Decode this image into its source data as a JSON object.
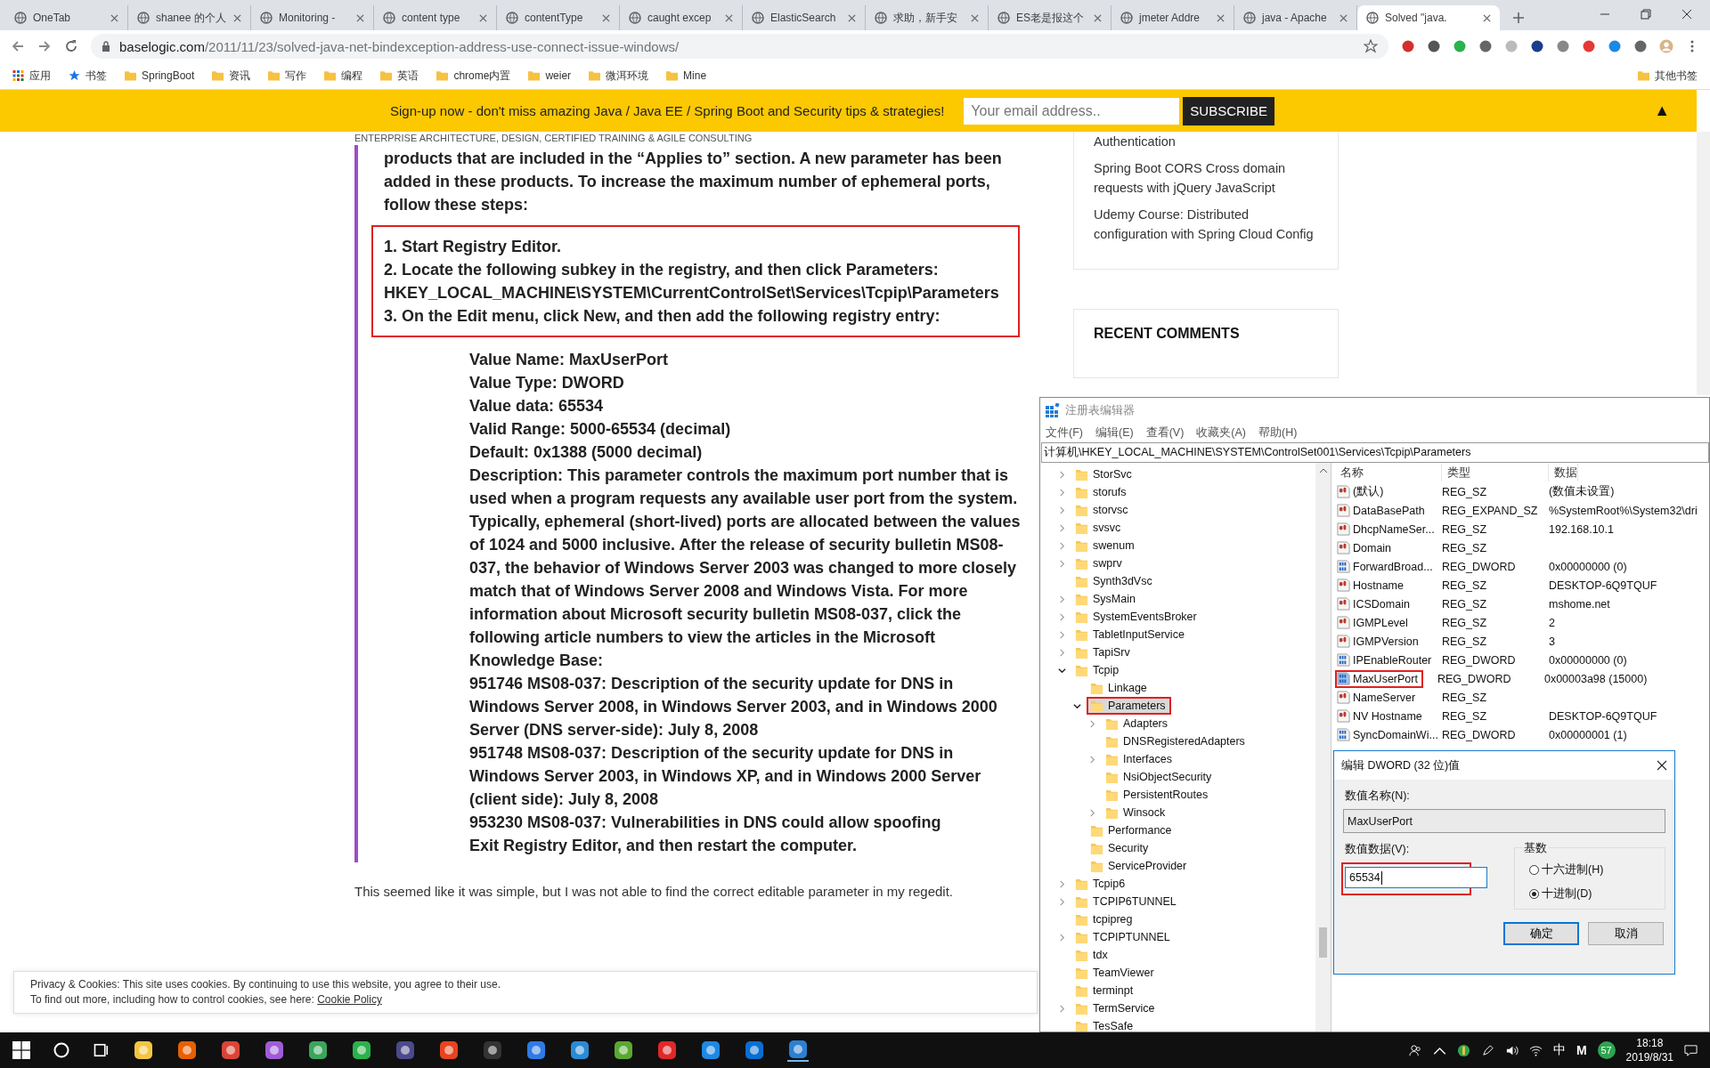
{
  "browser": {
    "tabs": [
      {
        "title": "OneTab",
        "selected": false
      },
      {
        "title": "shanee 的个人",
        "selected": false
      },
      {
        "title": "Monitoring -",
        "selected": false
      },
      {
        "title": "content type",
        "selected": false
      },
      {
        "title": "contentType",
        "selected": false
      },
      {
        "title": "caught excep",
        "selected": false
      },
      {
        "title": "ElasticSearch",
        "selected": false
      },
      {
        "title": "求助，新手安",
        "selected": false
      },
      {
        "title": "ES老是报这个",
        "selected": false
      },
      {
        "title": "jmeter Addre",
        "selected": false
      },
      {
        "title": "java - Apache",
        "selected": false
      },
      {
        "title": "Solved \"java.",
        "selected": true
      }
    ],
    "url": {
      "host": "baselogic.com",
      "path": "/2011/11/23/solved-java-net-bindexception-address-use-connect-issue-windows/"
    },
    "bookmarks": [
      {
        "label": "应用",
        "kind": "apps"
      },
      {
        "label": "书签",
        "kind": "star"
      },
      {
        "label": "SpringBoot",
        "kind": "folder"
      },
      {
        "label": "资讯",
        "kind": "folder"
      },
      {
        "label": "写作",
        "kind": "folder"
      },
      {
        "label": "编程",
        "kind": "folder"
      },
      {
        "label": "英语",
        "kind": "folder"
      },
      {
        "label": "chrome内置",
        "kind": "folder"
      },
      {
        "label": "weier",
        "kind": "folder"
      },
      {
        "label": "微洱环境",
        "kind": "folder"
      },
      {
        "label": "Mine",
        "kind": "folder"
      }
    ],
    "other_bookmarks": "其他书签"
  },
  "page": {
    "banner": {
      "text": "Sign-up now - don't miss amazing Java / Java EE / Spring Boot and Security tips & strategies!",
      "email_placeholder": "Your email address..",
      "subscribe": "SUBSCRIBE",
      "collapse": "▲"
    },
    "tagline": "ENTERPRISE ARCHITECTURE, DESIGN, CERTIFIED TRAINING & AGILE CONSULTING",
    "article": {
      "intro": "products that are included in the “Applies to” section. A new parameter has been added in these products. To increase the maximum number of ephemeral ports, follow these steps:",
      "steps": [
        "1. Start Registry Editor.",
        "2. Locate the following subkey in the registry, and then click Parameters: HKEY_LOCAL_MACHINE\\SYSTEM\\CurrentControlSet\\Services\\Tcpip\\Parameters",
        "3. On the Edit menu, click New, and then add the following registry entry:"
      ],
      "details": [
        "Value Name: MaxUserPort",
        "Value Type: DWORD",
        "Value data: 65534",
        "Valid Range: 5000-65534 (decimal)",
        "Default: 0x1388 (5000 decimal)",
        "Description: This parameter controls the maximum port number that is used when a program requests any available user port from the system. Typically, ephemeral (short-lived) ports are allocated between the values of 1024 and 5000 inclusive. After the release of security bulletin MS08-037, the behavior of Windows Server 2003 was changed to more closely match that of Windows Server 2008 and Windows Vista. For more information about Microsoft security bulletin MS08-037, click the following article numbers to view the articles in the Microsoft Knowledge Base:",
        "951746 MS08-037: Description of the security update for DNS in Windows Server 2008, in Windows Server 2003, and in Windows 2000 Server (DNS server-side): July 8, 2008",
        "951748 MS08-037: Description of the security update for DNS in Windows Server 2003, in Windows XP, and in Windows 2000 Server (client side): July 8, 2008",
        "953230 MS08-037: Vulnerabilities in DNS could allow spoofing",
        "Exit Registry Editor, and then restart the computer."
      ],
      "after": "This seemed like it was simple, but I was not able to find the correct editable parameter in my regedit."
    },
    "sidebar": {
      "links": [
        "Authentication",
        "Spring Boot CORS Cross domain requests with jQuery JavaScript",
        "Udemy Course: Distributed configuration with Spring Cloud Config"
      ],
      "heading": "RECENT COMMENTS"
    },
    "cookie": {
      "line1": "Privacy & Cookies: This site uses cookies. By continuing to use this website, you agree to their use.",
      "line2": "To find out more, including how to control cookies, see here:",
      "link": "Cookie Policy"
    }
  },
  "regedit": {
    "title": "注册表编辑器",
    "menu": [
      "文件(F)",
      "编辑(E)",
      "查看(V)",
      "收藏夹(A)",
      "帮助(H)"
    ],
    "address": "计算机\\HKEY_LOCAL_MACHINE\\SYSTEM\\ControlSet001\\Services\\Tcpip\\Parameters",
    "tree": [
      {
        "label": "StorSvc",
        "kind": "branch",
        "expanded": false,
        "selected": false,
        "boxed": false
      },
      {
        "label": "storufs",
        "kind": "branch",
        "expanded": false,
        "selected": false,
        "boxed": false
      },
      {
        "label": "storvsc",
        "kind": "branch",
        "expanded": false,
        "selected": false,
        "boxed": false
      },
      {
        "label": "svsvc",
        "kind": "branch",
        "expanded": false,
        "selected": false,
        "boxed": false
      },
      {
        "label": "swenum",
        "kind": "branch",
        "expanded": false,
        "selected": false,
        "boxed": false
      },
      {
        "label": "swprv",
        "kind": "branch",
        "expanded": false,
        "selected": false,
        "boxed": false
      },
      {
        "label": "Synth3dVsc",
        "kind": "leaf",
        "selected": false,
        "boxed": false
      },
      {
        "label": "SysMain",
        "kind": "branch",
        "expanded": false,
        "selected": false,
        "boxed": false
      },
      {
        "label": "SystemEventsBroker",
        "kind": "branch",
        "expanded": false,
        "selected": false,
        "boxed": false
      },
      {
        "label": "TabletInputService",
        "kind": "branch",
        "expanded": false,
        "selected": false,
        "boxed": false
      },
      {
        "label": "TapiSrv",
        "kind": "branch",
        "expanded": false,
        "selected": false,
        "boxed": false
      },
      {
        "label": "Tcpip",
        "kind": "branch",
        "expanded": true,
        "selected": false,
        "boxed": false,
        "children": [
          {
            "label": "Linkage",
            "kind": "leaf",
            "selected": false,
            "boxed": false
          },
          {
            "label": "Parameters",
            "kind": "branch",
            "expanded": true,
            "selected": true,
            "boxed": true,
            "children": [
              {
                "label": "Adapters",
                "kind": "branch",
                "expanded": false,
                "selected": false,
                "boxed": false
              },
              {
                "label": "DNSRegisteredAdapters",
                "kind": "leaf",
                "selected": false,
                "boxed": false
              },
              {
                "label": "Interfaces",
                "kind": "branch",
                "expanded": false,
                "selected": false,
                "boxed": false
              },
              {
                "label": "NsiObjectSecurity",
                "kind": "leaf",
                "selected": false,
                "boxed": false
              },
              {
                "label": "PersistentRoutes",
                "kind": "leaf",
                "selected": false,
                "boxed": false
              },
              {
                "label": "Winsock",
                "kind": "branch",
                "expanded": false,
                "selected": false,
                "boxed": false
              }
            ]
          },
          {
            "label": "Performance",
            "kind": "leaf",
            "selected": false,
            "boxed": false
          },
          {
            "label": "Security",
            "kind": "leaf",
            "selected": false,
            "boxed": false
          },
          {
            "label": "ServiceProvider",
            "kind": "leaf",
            "selected": false,
            "boxed": false
          }
        ]
      },
      {
        "label": "Tcpip6",
        "kind": "branch",
        "expanded": false,
        "selected": false,
        "boxed": false
      },
      {
        "label": "TCPIP6TUNNEL",
        "kind": "branch",
        "expanded": false,
        "selected": false,
        "boxed": false
      },
      {
        "label": "tcpipreg",
        "kind": "leaf",
        "selected": false,
        "boxed": false
      },
      {
        "label": "TCPIPTUNNEL",
        "kind": "branch",
        "expanded": false,
        "selected": false,
        "boxed": false
      },
      {
        "label": "tdx",
        "kind": "leaf",
        "selected": false,
        "boxed": false
      },
      {
        "label": "TeamViewer",
        "kind": "leaf",
        "selected": false,
        "boxed": false
      },
      {
        "label": "terminpt",
        "kind": "leaf",
        "selected": false,
        "boxed": false
      },
      {
        "label": "TermService",
        "kind": "branch",
        "expanded": false,
        "selected": false,
        "boxed": false
      },
      {
        "label": "TesSafe",
        "kind": "leaf",
        "selected": false,
        "boxed": false
      }
    ],
    "columns": [
      "名称",
      "类型",
      "数据"
    ],
    "values": [
      {
        "name": "(默认)",
        "type": "REG_SZ",
        "data": "(数值未设置)",
        "kind": "string",
        "boxed": false
      },
      {
        "name": "DataBasePath",
        "type": "REG_EXPAND_SZ",
        "data": "%SystemRoot%\\System32\\dri",
        "kind": "string",
        "boxed": false
      },
      {
        "name": "DhcpNameSer...",
        "type": "REG_SZ",
        "data": "192.168.10.1",
        "kind": "string",
        "boxed": false
      },
      {
        "name": "Domain",
        "type": "REG_SZ",
        "kind": "string",
        "boxed": false
      },
      {
        "name": "ForwardBroad...",
        "type": "REG_DWORD",
        "data": "0x00000000 (0)",
        "kind": "dword",
        "boxed": false
      },
      {
        "name": "Hostname",
        "type": "REG_SZ",
        "data": "DESKTOP-6Q9TQUF",
        "kind": "string",
        "boxed": false
      },
      {
        "name": "ICSDomain",
        "type": "REG_SZ",
        "data": "mshome.net",
        "kind": "string",
        "boxed": false
      },
      {
        "name": "IGMPLevel",
        "type": "REG_SZ",
        "data": "2",
        "kind": "string",
        "boxed": false
      },
      {
        "name": "IGMPVersion",
        "type": "REG_SZ",
        "data": "3",
        "kind": "string",
        "boxed": false
      },
      {
        "name": "IPEnableRouter",
        "type": "REG_DWORD",
        "data": "0x00000000 (0)",
        "kind": "dword",
        "boxed": false
      },
      {
        "name": "MaxUserPort",
        "type": "REG_DWORD",
        "data": "0x00003a98 (15000)",
        "kind": "dword",
        "boxed": true
      },
      {
        "name": "NameServer",
        "type": "REG_SZ",
        "kind": "string",
        "boxed": false
      },
      {
        "name": "NV Hostname",
        "type": "REG_SZ",
        "data": "DESKTOP-6Q9TQUF",
        "kind": "string",
        "boxed": false
      },
      {
        "name": "SyncDomainWi...",
        "type": "REG_DWORD",
        "data": "0x00000001 (1)",
        "kind": "dword",
        "boxed": false
      }
    ]
  },
  "dialog": {
    "title": "编辑 DWORD (32 位)值",
    "name_label": "数值名称(N):",
    "name_value": "MaxUserPort",
    "data_label": "数值数据(V):",
    "data_value": "65534",
    "data_boxed": true,
    "base_label": "基数",
    "bases": [
      {
        "label": "十六进制(H)",
        "selected": false
      },
      {
        "label": "十进制(D)",
        "selected": true
      }
    ],
    "buttons": [
      {
        "label": "确定",
        "default": true
      },
      {
        "label": "取消",
        "default": false
      }
    ]
  },
  "taskbar": {
    "ime": "中",
    "tray_letter": "M",
    "badge": "57",
    "time": "18:18",
    "date": "2019/8/31"
  }
}
